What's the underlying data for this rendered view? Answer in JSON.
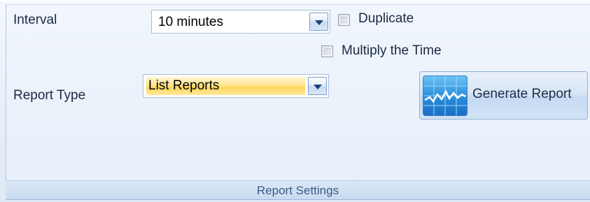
{
  "group": {
    "title": "Report Settings"
  },
  "interval": {
    "label": "Interval",
    "value": "10 minutes"
  },
  "options": {
    "duplicate_label": "Duplicate",
    "duplicate_checked": false,
    "multiply_label": "Multiply the Time",
    "multiply_checked": false
  },
  "report_type": {
    "label": "Report Type",
    "value": "List Reports"
  },
  "generate": {
    "label": "Generate Report",
    "icon": "chart-pulse-icon"
  }
}
